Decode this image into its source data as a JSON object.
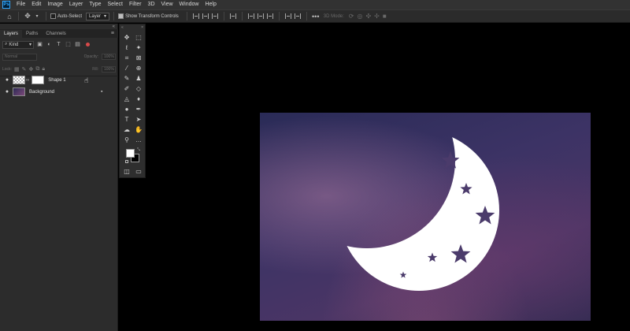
{
  "app": {
    "logo": "Ps"
  },
  "menu": [
    "File",
    "Edit",
    "Image",
    "Layer",
    "Type",
    "Select",
    "Filter",
    "3D",
    "View",
    "Window",
    "Help"
  ],
  "options": {
    "auto_select_label": "Auto-Select",
    "auto_select_target": "Layer",
    "show_transform_label": "Show Transform Controls",
    "mode_3d_label": "3D Mode:"
  },
  "layers_panel": {
    "tabs": [
      "Layers",
      "Paths",
      "Channels"
    ],
    "active_tab": "Layers",
    "filter_kind": "Kind",
    "blend_mode": "Normal",
    "opacity_label": "Opacity:",
    "opacity_value": "100%",
    "lock_label": "Lock:",
    "fill_label": "Fill:",
    "fill_value": "100%",
    "layers": [
      {
        "name": "Shape 1",
        "visible": true,
        "locked": false
      },
      {
        "name": "Background",
        "visible": true,
        "locked": true
      }
    ]
  },
  "tools_panel": {
    "foreground_color": "#ffffff",
    "background_color": "#000000"
  },
  "colors": {
    "app_background": "#000000",
    "panel": "#2c2c2c",
    "menubar": "#323232",
    "canvas_top": "#2a2b57",
    "canvas_mid": "#4a3565",
    "moon": "#ffffff",
    "stars": "#4b3b6b"
  }
}
